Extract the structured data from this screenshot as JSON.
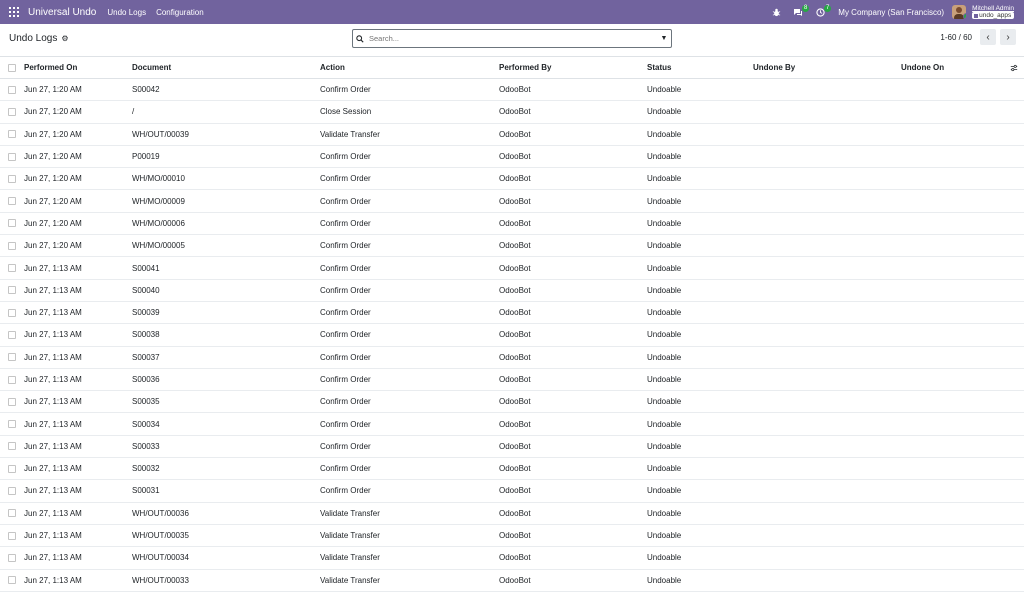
{
  "navbar": {
    "brand": "Universal Undo",
    "menu": [
      "Undo Logs",
      "Configuration"
    ],
    "activity_badge": "8",
    "clock_badge": "7",
    "company": "My Company (San Francisco)",
    "user_name": "Mitchell Admin",
    "db_name": "undo_apps",
    "bar_color": "#71639e"
  },
  "control_panel": {
    "title": "Undo Logs",
    "search_placeholder": "Search...",
    "pager": "1-60 / 60"
  },
  "table": {
    "headers": [
      "Performed On",
      "Document",
      "Action",
      "Performed By",
      "Status",
      "Undone By",
      "Undone On"
    ],
    "rows": [
      [
        "Jun 27, 1:20 AM",
        "S00042",
        "Confirm Order",
        "OdooBot",
        "Undoable"
      ],
      [
        "Jun 27, 1:20 AM",
        "/",
        "Close Session",
        "OdooBot",
        "Undoable"
      ],
      [
        "Jun 27, 1:20 AM",
        "WH/OUT/00039",
        "Validate Transfer",
        "OdooBot",
        "Undoable"
      ],
      [
        "Jun 27, 1:20 AM",
        "P00019",
        "Confirm Order",
        "OdooBot",
        "Undoable"
      ],
      [
        "Jun 27, 1:20 AM",
        "WH/MO/00010",
        "Confirm Order",
        "OdooBot",
        "Undoable"
      ],
      [
        "Jun 27, 1:20 AM",
        "WH/MO/00009",
        "Confirm Order",
        "OdooBot",
        "Undoable"
      ],
      [
        "Jun 27, 1:20 AM",
        "WH/MO/00006",
        "Confirm Order",
        "OdooBot",
        "Undoable"
      ],
      [
        "Jun 27, 1:20 AM",
        "WH/MO/00005",
        "Confirm Order",
        "OdooBot",
        "Undoable"
      ],
      [
        "Jun 27, 1:13 AM",
        "S00041",
        "Confirm Order",
        "OdooBot",
        "Undoable"
      ],
      [
        "Jun 27, 1:13 AM",
        "S00040",
        "Confirm Order",
        "OdooBot",
        "Undoable"
      ],
      [
        "Jun 27, 1:13 AM",
        "S00039",
        "Confirm Order",
        "OdooBot",
        "Undoable"
      ],
      [
        "Jun 27, 1:13 AM",
        "S00038",
        "Confirm Order",
        "OdooBot",
        "Undoable"
      ],
      [
        "Jun 27, 1:13 AM",
        "S00037",
        "Confirm Order",
        "OdooBot",
        "Undoable"
      ],
      [
        "Jun 27, 1:13 AM",
        "S00036",
        "Confirm Order",
        "OdooBot",
        "Undoable"
      ],
      [
        "Jun 27, 1:13 AM",
        "S00035",
        "Confirm Order",
        "OdooBot",
        "Undoable"
      ],
      [
        "Jun 27, 1:13 AM",
        "S00034",
        "Confirm Order",
        "OdooBot",
        "Undoable"
      ],
      [
        "Jun 27, 1:13 AM",
        "S00033",
        "Confirm Order",
        "OdooBot",
        "Undoable"
      ],
      [
        "Jun 27, 1:13 AM",
        "S00032",
        "Confirm Order",
        "OdooBot",
        "Undoable"
      ],
      [
        "Jun 27, 1:13 AM",
        "S00031",
        "Confirm Order",
        "OdooBot",
        "Undoable"
      ],
      [
        "Jun 27, 1:13 AM",
        "WH/OUT/00036",
        "Validate Transfer",
        "OdooBot",
        "Undoable"
      ],
      [
        "Jun 27, 1:13 AM",
        "WH/OUT/00035",
        "Validate Transfer",
        "OdooBot",
        "Undoable"
      ],
      [
        "Jun 27, 1:13 AM",
        "WH/OUT/00034",
        "Validate Transfer",
        "OdooBot",
        "Undoable"
      ],
      [
        "Jun 27, 1:13 AM",
        "WH/OUT/00033",
        "Validate Transfer",
        "OdooBot",
        "Undoable"
      ]
    ]
  }
}
